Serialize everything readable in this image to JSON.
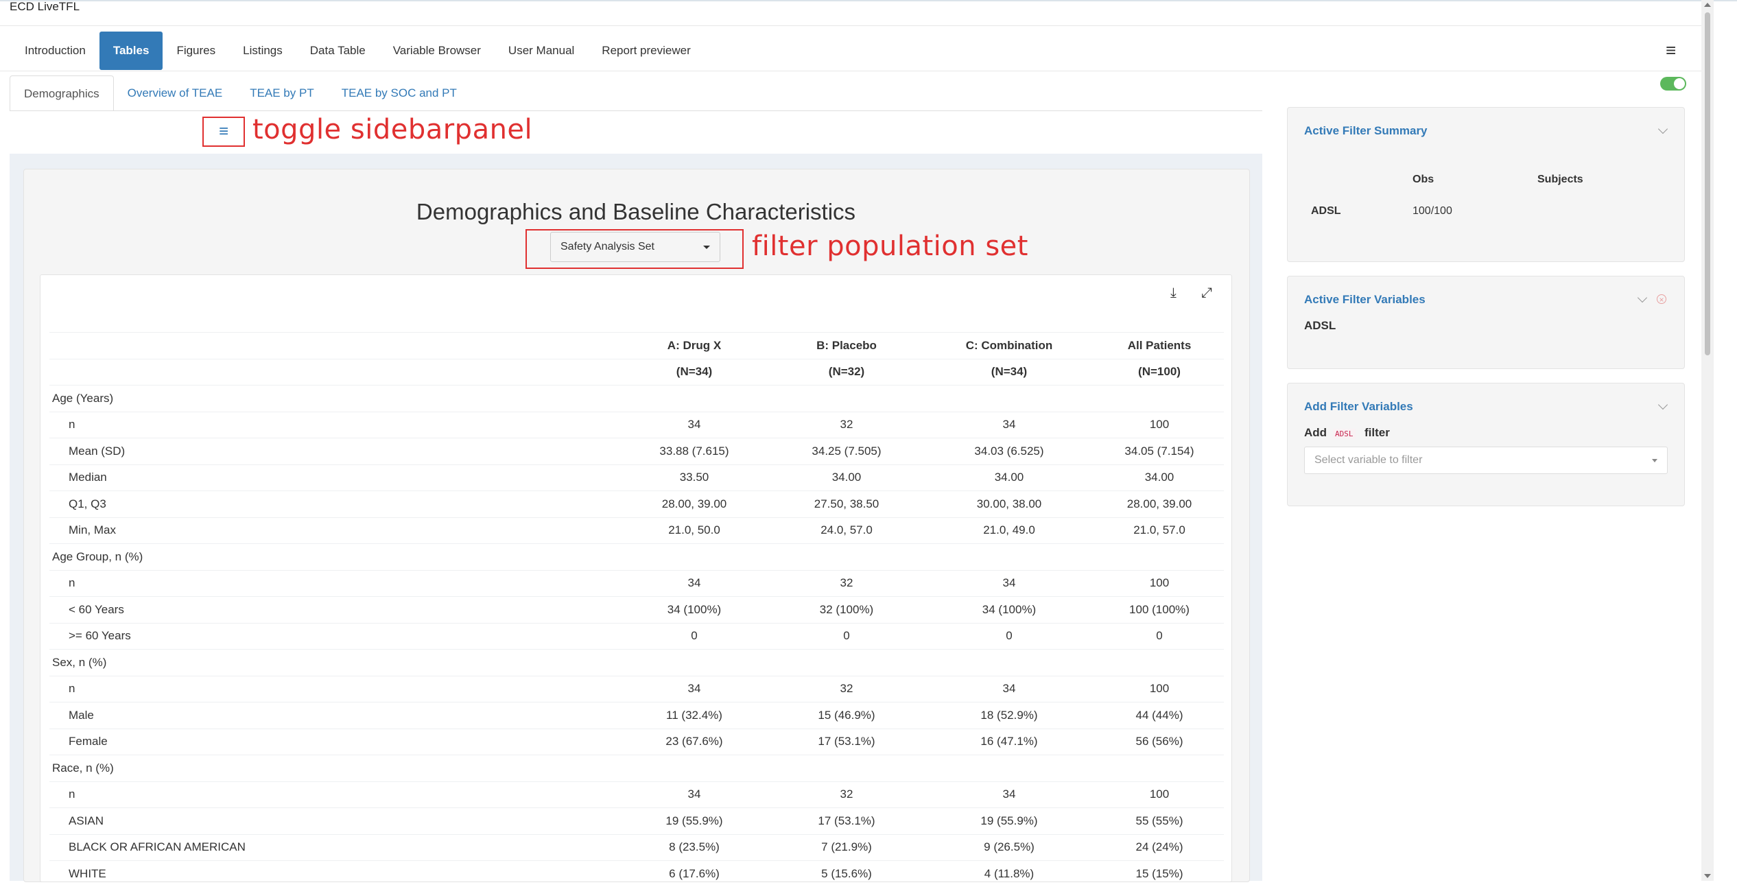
{
  "app": {
    "title": "ECD LiveTFL"
  },
  "nav": {
    "items": [
      {
        "label": "Introduction",
        "active": false
      },
      {
        "label": "Tables",
        "active": true
      },
      {
        "label": "Figures",
        "active": false
      },
      {
        "label": "Listings",
        "active": false
      },
      {
        "label": "Data Table",
        "active": false
      },
      {
        "label": "Variable Browser",
        "active": false
      },
      {
        "label": "User Manual",
        "active": false
      },
      {
        "label": "Report previewer",
        "active": false
      }
    ],
    "menu_icon": "≡"
  },
  "subtabs": {
    "items": [
      {
        "label": "Demographics",
        "active": true
      },
      {
        "label": "Overview of TEAE",
        "active": false
      },
      {
        "label": "TEAE by PT",
        "active": false
      },
      {
        "label": "TEAE by SOC and PT",
        "active": false
      }
    ]
  },
  "annotations": {
    "sidebar_toggle_icon": "≡",
    "sidebar_toggle_label": "toggle sidebarpanel",
    "filter_label": "filter population set"
  },
  "main": {
    "title": "Demographics and Baseline Characteristics",
    "population_select": "Safety Analysis Set",
    "download_icon": "⤓",
    "expand_icon": "⤢"
  },
  "table": {
    "headers": [
      "A: Drug X",
      "B: Placebo",
      "C: Combination",
      "All Patients"
    ],
    "counts": [
      "(N=34)",
      "(N=32)",
      "(N=34)",
      "(N=100)"
    ],
    "rows": [
      {
        "label": "Age (Years)",
        "sub": false,
        "values": [
          "",
          "",
          "",
          ""
        ]
      },
      {
        "label": "n",
        "sub": true,
        "values": [
          "34",
          "32",
          "34",
          "100"
        ]
      },
      {
        "label": "Mean (SD)",
        "sub": true,
        "values": [
          "33.88 (7.615)",
          "34.25 (7.505)",
          "34.03 (6.525)",
          "34.05 (7.154)"
        ]
      },
      {
        "label": "Median",
        "sub": true,
        "values": [
          "33.50",
          "34.00",
          "34.00",
          "34.00"
        ]
      },
      {
        "label": "Q1, Q3",
        "sub": true,
        "values": [
          "28.00, 39.00",
          "27.50, 38.50",
          "30.00, 38.00",
          "28.00, 39.00"
        ]
      },
      {
        "label": "Min, Max",
        "sub": true,
        "values": [
          "21.0, 50.0",
          "24.0, 57.0",
          "21.0, 49.0",
          "21.0, 57.0"
        ]
      },
      {
        "label": "Age Group, n (%)",
        "sub": false,
        "values": [
          "",
          "",
          "",
          ""
        ]
      },
      {
        "label": "n",
        "sub": true,
        "values": [
          "34",
          "32",
          "34",
          "100"
        ]
      },
      {
        "label": "< 60 Years",
        "sub": true,
        "values": [
          "34 (100%)",
          "32 (100%)",
          "34 (100%)",
          "100 (100%)"
        ]
      },
      {
        "label": ">= 60 Years",
        "sub": true,
        "values": [
          "0",
          "0",
          "0",
          "0"
        ]
      },
      {
        "label": "Sex, n (%)",
        "sub": false,
        "values": [
          "",
          "",
          "",
          ""
        ]
      },
      {
        "label": "n",
        "sub": true,
        "values": [
          "34",
          "32",
          "34",
          "100"
        ]
      },
      {
        "label": "Male",
        "sub": true,
        "values": [
          "11 (32.4%)",
          "15 (46.9%)",
          "18 (52.9%)",
          "44 (44%)"
        ]
      },
      {
        "label": "Female",
        "sub": true,
        "values": [
          "23 (67.6%)",
          "17 (53.1%)",
          "16 (47.1%)",
          "56 (56%)"
        ]
      },
      {
        "label": "Race, n (%)",
        "sub": false,
        "values": [
          "",
          "",
          "",
          ""
        ]
      },
      {
        "label": "n",
        "sub": true,
        "values": [
          "34",
          "32",
          "34",
          "100"
        ]
      },
      {
        "label": "ASIAN",
        "sub": true,
        "values": [
          "19 (55.9%)",
          "17 (53.1%)",
          "19 (55.9%)",
          "55 (55%)"
        ]
      },
      {
        "label": "BLACK OR AFRICAN AMERICAN",
        "sub": true,
        "values": [
          "8 (23.5%)",
          "7 (21.9%)",
          "9 (26.5%)",
          "24 (24%)"
        ]
      },
      {
        "label": "WHITE",
        "sub": true,
        "values": [
          "6 (17.6%)",
          "5 (15.6%)",
          "4 (11.8%)",
          "15 (15%)"
        ]
      }
    ]
  },
  "sidebar": {
    "summary": {
      "title": "Active Filter Summary",
      "col_obs": "Obs",
      "col_subjects": "Subjects",
      "dataset": "ADSL",
      "obs": "100/100"
    },
    "active_vars": {
      "title": "Active Filter Variables",
      "dataset": "ADSL"
    },
    "add_vars": {
      "title": "Add Filter Variables",
      "add_prefix": "Add",
      "tag": "ADSL",
      "add_suffix": "filter",
      "placeholder": "Select variable to filter"
    }
  },
  "colors": {
    "accent": "#337ab7",
    "annotation": "#e03030",
    "toggle_on": "#5cb85c"
  }
}
